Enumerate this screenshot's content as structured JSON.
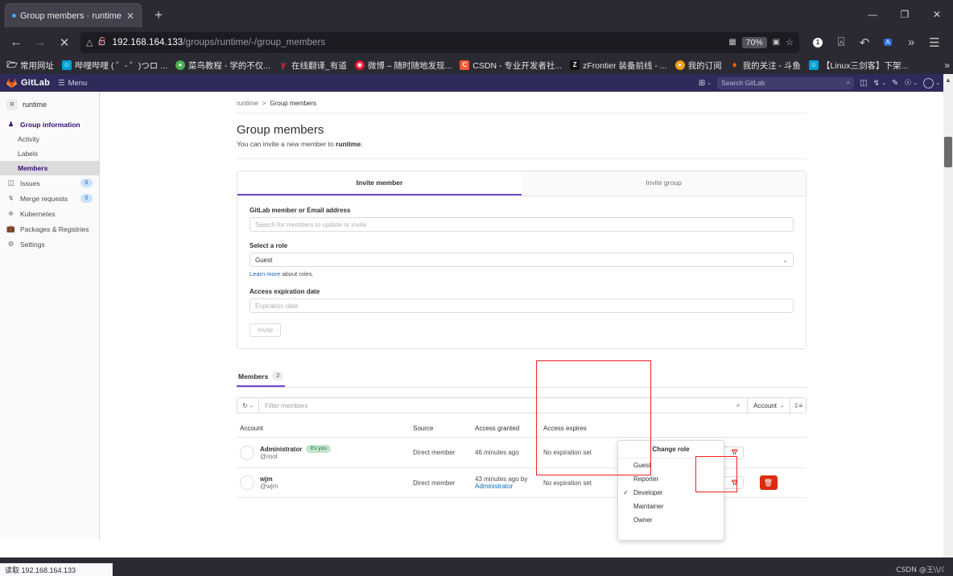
{
  "browser": {
    "tab": {
      "title": "Group members · runtime · G",
      "favicon": "loading-dot",
      "close_label": "✕"
    },
    "new_tab_label": "+",
    "window_controls": {
      "minimize": "—",
      "maximize": "❐",
      "close": "✕"
    },
    "nav": {
      "back": "←",
      "forward": "→",
      "stop": "✕",
      "shield_icon": "shield-icon",
      "permissions_icon": "broken-lock-icon",
      "url_host": "192.168.164.133",
      "url_path": "/groups/runtime/-/group_members",
      "qr_icon": "qr-code-icon",
      "zoom_level": "70%",
      "translate_icon": "translate-icon",
      "bookmark_icon": "star-icon",
      "account_badge": "1",
      "screenshot_icon": "crop-icon",
      "undo_icon": "undo-icon",
      "translate2_icon": "translate-page-icon",
      "overflow_icon": "»",
      "menu_icon": "hamburger-menu-icon"
    },
    "bookmarks": [
      {
        "label": "常用网址",
        "icon": "folder-icon",
        "color": "#2b2a33",
        "glyph": "▢"
      },
      {
        "label": "哔哩哔哩 ( ゜- ゜)つロ ...",
        "icon": "bilibili-icon",
        "color": "#00a1d6",
        "glyph": "▣"
      },
      {
        "label": "菜鸟教程 - 学的不仅...",
        "icon": "runoob-icon",
        "color": "#4caf50",
        "glyph": "●"
      },
      {
        "label": "在线翻译_有道",
        "icon": "youdao-icon",
        "color": "#d32f2f",
        "glyph": "У"
      },
      {
        "label": "微博 – 随时随地发现...",
        "icon": "weibo-icon",
        "color": "#e6162d",
        "glyph": "◉"
      },
      {
        "label": "CSDN - 专业开发者社...",
        "icon": "csdn-icon",
        "color": "#fc5531",
        "glyph": "C"
      },
      {
        "label": "zFrontier 装备前线 - ...",
        "icon": "zfrontier-icon",
        "color": "#111111",
        "glyph": "Z"
      },
      {
        "label": "我的订阅",
        "icon": "subscribe-icon",
        "color": "#f39c12",
        "glyph": "●"
      },
      {
        "label": "我的关注 - 斗鱼",
        "icon": "douyu-icon",
        "color": "#ff6600",
        "glyph": "♦"
      },
      {
        "label": "【Linux三剑客】下架...",
        "icon": "bilibili-icon",
        "color": "#00a1d6",
        "glyph": "▣"
      }
    ],
    "bookmarks_overflow": "»"
  },
  "gitlab_header": {
    "brand": "GitLab",
    "menu_label": "Menu",
    "plus_icon": "plus-square-icon",
    "search_placeholder": "Search GitLab",
    "search_icon": "search-icon",
    "issues_icon": "issues-icon",
    "merge_requests_icon": "merge-request-icon",
    "todos_icon": "todo-icon",
    "help_icon": "help-icon",
    "avatar_icon": "user-avatar-icon"
  },
  "sidebar": {
    "group_initial": "R",
    "group_name": "runtime",
    "items": [
      {
        "label": "Group information",
        "icon": "group-info-icon",
        "active": false,
        "header": true
      },
      {
        "label": "Activity",
        "icon": "",
        "sub": true
      },
      {
        "label": "Labels",
        "icon": "",
        "sub": true
      },
      {
        "label": "Members",
        "icon": "",
        "sub": true,
        "active": true
      },
      {
        "label": "Issues",
        "icon": "issues-icon",
        "badge": "0"
      },
      {
        "label": "Merge requests",
        "icon": "merge-request-icon",
        "badge": "0"
      },
      {
        "label": "Kubernetes",
        "icon": "kubernetes-icon"
      },
      {
        "label": "Packages & Registries",
        "icon": "package-icon"
      },
      {
        "label": "Settings",
        "icon": "gear-icon"
      }
    ]
  },
  "page": {
    "breadcrumb": {
      "root": "runtime",
      "separator": ">",
      "current": "Group members"
    },
    "title": "Group members",
    "subtitle_pre": "You can invite a new member to ",
    "subtitle_group": "runtime",
    "subtitle_post": ".",
    "invite_card": {
      "tabs": [
        {
          "label": "Invite member",
          "active": true
        },
        {
          "label": "Invite group",
          "active": false
        }
      ],
      "member_field_label": "GitLab member or Email address",
      "member_field_placeholder": "Search for members to update or invite",
      "role_label": "Select a role",
      "role_value": "Guest",
      "role_chevron": "⌄",
      "help_link": "Learn more",
      "help_rest": " about roles.",
      "expiration_label": "Access expiration date",
      "expiration_placeholder": "Expiration date",
      "invite_button": "Invite"
    },
    "members": {
      "tab_label": "Members",
      "tab_count": "2",
      "history_icon": "history-icon",
      "history_chevron": "⌄",
      "filter_placeholder": "Filter members",
      "search_icon": "search-icon",
      "sort_label": "Account",
      "sort_chevron": "⌄",
      "sort_direction_icon": "sort-descending-icon",
      "columns": [
        "Account",
        "Source",
        "Access granted",
        "Access expires",
        "",
        ""
      ],
      "rows": [
        {
          "avatar": "user-avatar-icon",
          "name": "Administrator",
          "badge": "It's you",
          "handle": "@root",
          "source": "Direct member",
          "granted": "46 minutes ago",
          "granted_by": "",
          "expires": "No expiration set",
          "role": "",
          "expiration_placeholder": "Expiration date",
          "calendar_icon": "calendar-icon",
          "has_role_control": false,
          "has_delete": false
        },
        {
          "avatar": "user-avatar-icon",
          "name": "wjm",
          "badge": "",
          "handle": "@wjm",
          "source": "Direct member",
          "granted": "43 minutes ago by",
          "granted_by": "Administrator",
          "expires": "No expiration set",
          "role": "Developer",
          "role_chevron": "⌄",
          "expiration_placeholder": "Expiration date",
          "calendar_icon": "calendar-icon",
          "has_role_control": true,
          "has_delete": true,
          "delete_icon": "trash-icon"
        }
      ]
    },
    "role_dropdown": {
      "header": "Change role",
      "options": [
        {
          "label": "Guest",
          "selected": false
        },
        {
          "label": "Reporter",
          "selected": false
        },
        {
          "label": "Developer",
          "selected": true
        },
        {
          "label": "Maintainer",
          "selected": false
        },
        {
          "label": "Owner",
          "selected": false
        }
      ],
      "check_glyph": "✓"
    }
  },
  "status_bar": {
    "text": "读取 192.168.164.133"
  },
  "watermark": {
    "text": "CSDN @王\\\\/☾"
  },
  "colors": {
    "gitlab_purple": "#6e49cb",
    "gitlab_nav": "#2e2b5b",
    "link_blue": "#1068bf",
    "danger_red": "#dd2b0e",
    "highlight_red": "#ee2222"
  }
}
